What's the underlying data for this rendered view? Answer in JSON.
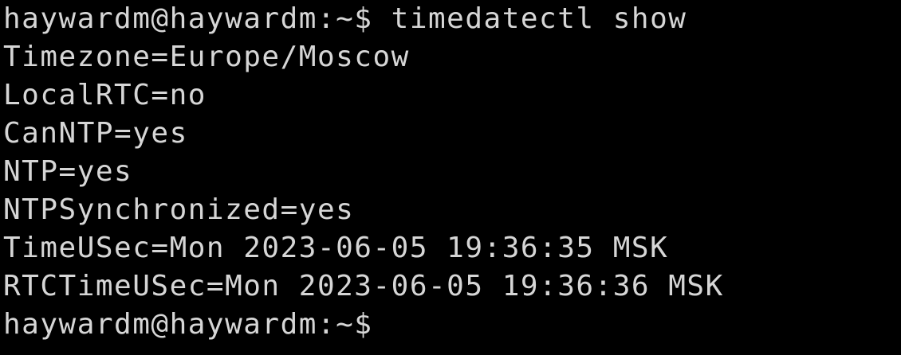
{
  "terminal": {
    "background": "#000000",
    "foreground": "#d6d6d6",
    "lines": [
      "haywardm@haywardm:~$ timedatectl show",
      "Timezone=Europe/Moscow",
      "LocalRTC=no",
      "CanNTP=yes",
      "NTP=yes",
      "NTPSynchronized=yes",
      "TimeUSec=Mon 2023-06-05 19:36:35 MSK",
      "RTCTimeUSec=Mon 2023-06-05 19:36:36 MSK",
      "haywardm@haywardm:~$"
    ]
  }
}
